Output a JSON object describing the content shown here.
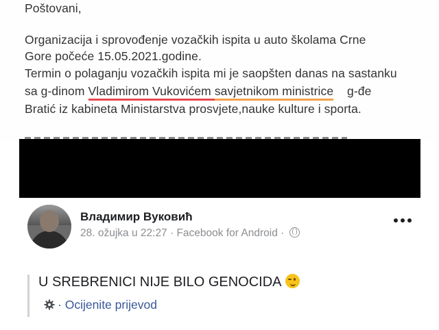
{
  "letter": {
    "greeting": "Poštovani,",
    "line1": "Organizacija i sprovođenje  vozačkih ispita u auto školama Crne",
    "line2": "Gore počeće 15.05.2021.godine.",
    "line3": "Termin o polaganju vozačkih ispita mi je saopšten danas na sastanku",
    "line4_a": "sa g-dinom ",
    "line4_name": "Vladimirom Vukovićem",
    "line4_space": " ",
    "line4_role": "savjetnikom ministrice",
    "line4_b": "    g-đe",
    "line5": "Bratić iz kabineta Ministarstva prosvjete,nauke kulture i sporta."
  },
  "post": {
    "author": "Владимир Вуковић",
    "date": "28. ožujka u 22:27",
    "separator": " · ",
    "source": "Facebook for Android",
    "separator2": " · ",
    "text": "U SREBRENICI NIJE BILO GENOCIDA",
    "translate_prefix": "· ",
    "translate_label": "Ocijenite prijevod"
  },
  "icons": {
    "globe": "globe-icon",
    "more": "more-options-icon",
    "gear": "gear-icon",
    "emoji": "winking-face-emoji"
  },
  "colors": {
    "underline_name": "#e8484f",
    "underline_role": "#f2a04a",
    "link": "#385898"
  }
}
